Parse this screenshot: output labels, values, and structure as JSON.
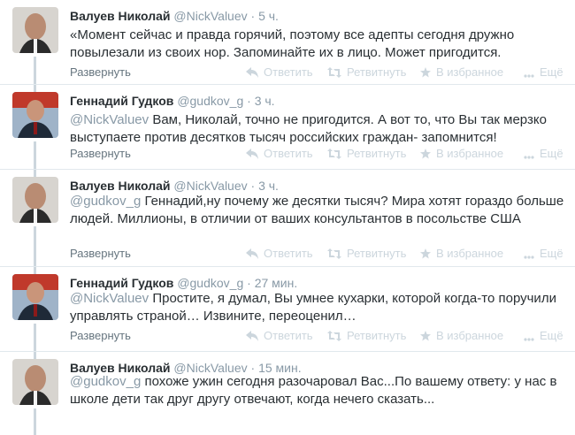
{
  "actions": {
    "expand": "Развернуть",
    "reply": "Ответить",
    "retweet": "Ретвитнуть",
    "favorite": "В избранное",
    "more": "Ещё"
  },
  "tweets": [
    {
      "fullname": "Валуев Николай",
      "handle": "@NickValuev",
      "dot": "·",
      "time": "5 ч.",
      "mention": "",
      "text": "«Момент сейчас и правда горячий, поэтому все адепты сегодня дружно повылезали из своих нор. Запоминайте их в лицо. Может пригодится."
    },
    {
      "fullname": "Геннадий Гудков",
      "handle": "@gudkov_g",
      "dot": "·",
      "time": "3 ч.",
      "mention": "@NickValuev",
      "text": " Вам, Николай, точно не пригодится. А вот то, что Вы так мерзко выступаете против десятков тысяч российских граждан- запомнится!"
    },
    {
      "fullname": "Валуев Николай",
      "handle": "@NickValuev",
      "dot": "·",
      "time": "3 ч.",
      "mention": "@gudkov_g",
      "text": " Геннадий,ну почему же десятки тысяч? Мира хотят гораздо больше людей. Миллионы, в отличии от ваших консультантов в посольстве США"
    },
    {
      "fullname": "Геннадий Гудков",
      "handle": "@gudkov_g",
      "dot": "·",
      "time": "27 мин.",
      "mention": "@NickValuev",
      "text": " Простите, я думал, Вы умнее кухарки, которой когда-то поручили управлять страной… Извините, переоценил…"
    },
    {
      "fullname": "Валуев Николай",
      "handle": "@NickValuev",
      "dot": "·",
      "time": "15 мин.",
      "mention": "@gudkov_g",
      "text": " похоже ужин сегодня разочаровал Вас...По вашему ответу: у нас в школе дети так друг другу отвечают, когда нечего сказать..."
    }
  ]
}
